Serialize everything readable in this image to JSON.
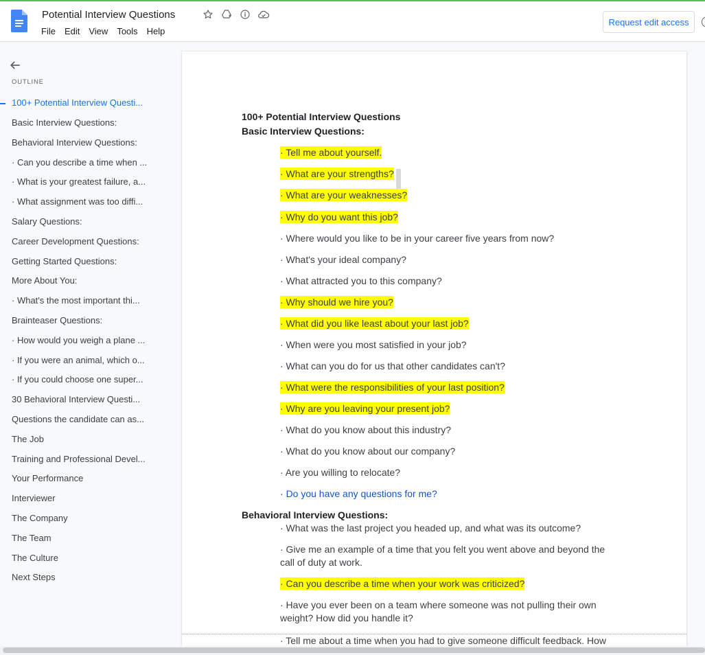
{
  "app": {
    "title": "Potential Interview Questions",
    "menu": [
      "File",
      "Edit",
      "View",
      "Tools",
      "Help"
    ],
    "request_button": "Request edit access",
    "colors": {
      "accent": "#1a73e8",
      "doc_icon": "#4285f4",
      "highlight": "#ffff00",
      "link": "#1155cc"
    }
  },
  "outline": {
    "label": "OUTLINE",
    "items": [
      "100+ Potential Interview Questi...",
      "Basic Interview Questions:",
      "Behavioral Interview Questions:",
      "· Can you describe a time when ...",
      "· What is your greatest failure, a...",
      "· What assignment was too diffi...",
      "Salary Questions:",
      "Career Development Questions:",
      "Getting Started Questions:",
      "More About You:",
      "· What's the most important thi...",
      "Brainteaser Questions:",
      "· How would you weigh a plane ...",
      "· If you were an animal, which o...",
      "· If you could choose one super...",
      "30 Behavioral Interview Questi...",
      "Questions the candidate can as...",
      "The Job",
      "Training and Professional Devel...",
      "Your Performance",
      "Interviewer",
      "The Company",
      "The Team",
      "The Culture",
      "Next Steps"
    ]
  },
  "doc": {
    "title": "100+ Potential Interview Questions",
    "basic_heading": "Basic Interview Questions:",
    "basic_questions": [
      "· Tell me about yourself.",
      "· What are your strengths?",
      "· What are your weaknesses?",
      "· Why do you want this job?",
      "· Where would you like to be in your career five years from now?",
      "· What's your ideal company?",
      "· What attracted you to this company?",
      "· Why should we hire you?",
      "· What did you like least about your last job?",
      "· When were you most satisfied in your job?",
      "· What can you do for us that other candidates can't?",
      "· What were the responsibilities of your last position?",
      "· Why are you leaving your present job?",
      "· What do you know about this industry?",
      "· What do you know about our company?",
      "· Are you willing to relocate?"
    ],
    "link_bullet": "·",
    "link_question": "Do you have any questions for me?",
    "behavioral_heading": "Behavioral Interview Questions:",
    "behavioral_questions": [
      "· What was the last project you headed up, and what was its outcome?",
      "· Give me an example of a time that you felt you went above and beyond the",
      "call of duty at work.",
      "· Can you describe a time when your work was criticized?",
      "· Have you ever been on a team where someone was not pulling their own",
      "weight? How did you handle it?",
      "· Tell me about a time when you had to give someone difficult feedback. How"
    ]
  }
}
